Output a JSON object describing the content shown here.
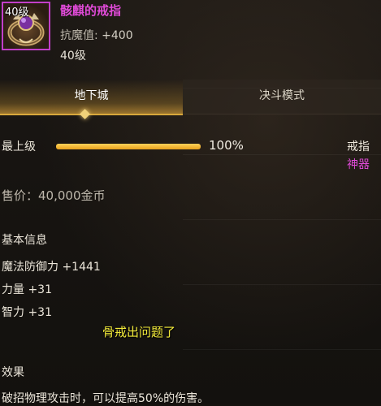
{
  "item": {
    "icon_level": "40级",
    "name": "骸麒的戒指",
    "stat_label": "抗魔值:",
    "stat_value": "+400",
    "level": "40级",
    "name_color": "#e04ad8",
    "icon_border_color": "#c23fc9"
  },
  "tabs": [
    {
      "label": "地下城",
      "active": true
    },
    {
      "label": "决斗模式",
      "active": false
    }
  ],
  "upgrade": {
    "label": "最上级",
    "percent_text": "100%",
    "progress": 1.0
  },
  "slot": "戒指",
  "rarity": "神器",
  "price": "售价：40,000金币",
  "basic_info": {
    "title": "基本信息",
    "attributes": [
      "魔法防御力 +1441",
      "力量 +31",
      "智力 +31"
    ]
  },
  "overlay_caption": "骨戒出问题了",
  "effect": {
    "title": "效果",
    "text": "破招物理攻击时，可以提高50%的伤害。"
  }
}
